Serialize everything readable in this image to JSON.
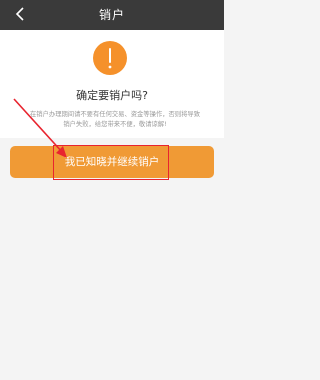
{
  "nav": {
    "title": "销户",
    "back_icon": "chevron-left-icon"
  },
  "dialog": {
    "warning_icon": "exclamation-circle-icon",
    "warning_color": "#f5912b",
    "heading": "确定要销户吗?",
    "notice": "在销户办理期间请不要有任何交易、资金等操作，否则将导致销户失败，给您带来不便，敬请谅解!"
  },
  "confirm_button": {
    "label": "我已知晓并继续销户",
    "color": "#f09a35"
  },
  "annotation": {
    "highlight_color": "#e8242f"
  }
}
